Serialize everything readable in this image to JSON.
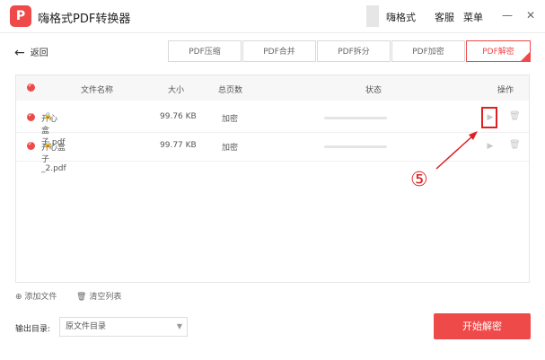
{
  "app": {
    "logo_letter": "P",
    "title": "嗨格式PDF转换器"
  },
  "titlebar": {
    "user": "嗨格式",
    "service": "客服",
    "menu": "菜单",
    "minimize": "—",
    "close": "✕"
  },
  "nav": {
    "back_label": "返回"
  },
  "tabs": [
    {
      "label": "PDF压缩"
    },
    {
      "label": "PDF合并"
    },
    {
      "label": "PDF拆分"
    },
    {
      "label": "PDF加密"
    },
    {
      "label": "PDF解密",
      "active": true
    }
  ],
  "table": {
    "headers": {
      "name": "文件名称",
      "size": "大小",
      "pages": "总页数",
      "status": "状态",
      "actions": "操作"
    },
    "rows": [
      {
        "name": "开心盒子.pdf",
        "size": "99.76 KB",
        "pages": "加密",
        "progress": 0
      },
      {
        "name": "开心盒子_2.pdf",
        "size": "99.77 KB",
        "pages": "加密",
        "progress": 0
      }
    ]
  },
  "annotation": {
    "label": "⑤",
    "color": "#e02020"
  },
  "footer": {
    "add_file": "添加文件",
    "clear_list": "清空列表"
  },
  "output": {
    "label": "输出目录:",
    "value": "原文件目录"
  },
  "start_button": "开始解密",
  "colors": {
    "accent": "#ef4a4a"
  }
}
